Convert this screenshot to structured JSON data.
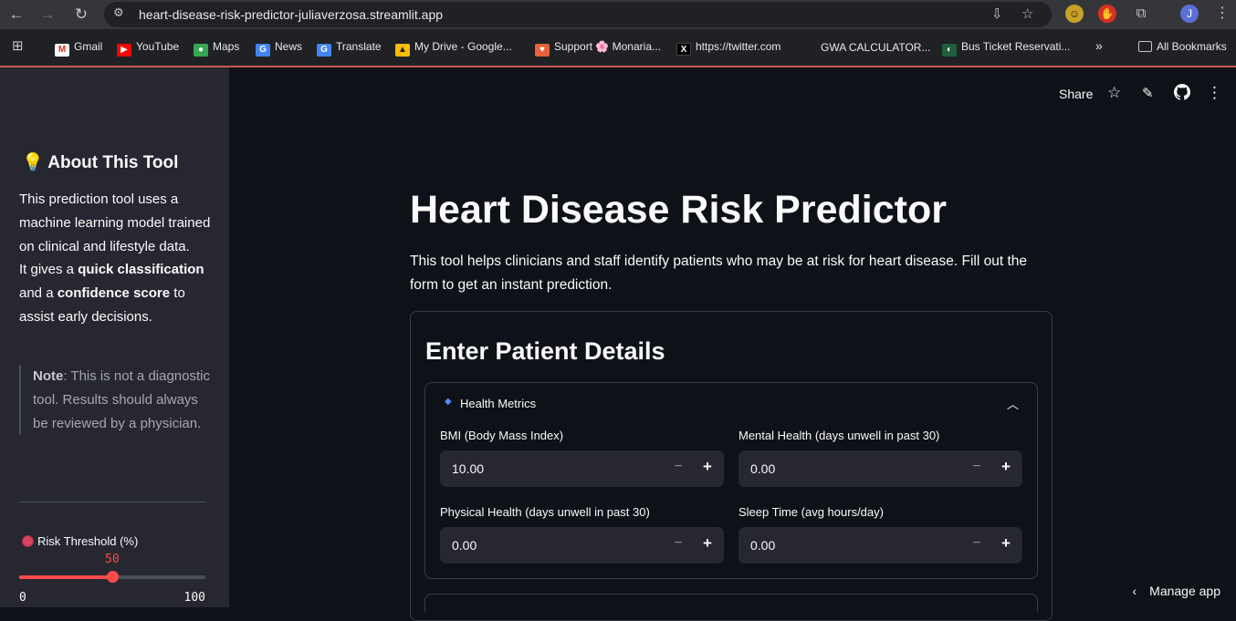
{
  "browser": {
    "url": "heart-disease-risk-predictor-juliaverzosa.streamlit.app",
    "profile_initial": "J",
    "bookmarks": [
      {
        "label": "Gmail",
        "icon": "gmail-icon"
      },
      {
        "label": "YouTube",
        "icon": "youtube-icon"
      },
      {
        "label": "Maps",
        "icon": "maps-icon"
      },
      {
        "label": "News",
        "icon": "news-icon"
      },
      {
        "label": "Translate",
        "icon": "translate-icon"
      },
      {
        "label": "My Drive - Google...",
        "icon": "drive-icon"
      },
      {
        "label": "Support 🌸 Monaria...",
        "icon": "support-icon"
      },
      {
        "label": "https://twitter.com",
        "icon": "x-icon"
      },
      {
        "label": "GWA CALCULATOR...",
        "icon": "page-icon"
      },
      {
        "label": "Bus Ticket Reservati...",
        "icon": "bus-icon"
      }
    ],
    "all_bookmarks": "All Bookmarks"
  },
  "topbar": {
    "share": "Share"
  },
  "sidebar": {
    "heading": "About This Tool",
    "heading_icon": "💡",
    "intro_1": "This prediction tool uses a machine learning model trained on clinical and lifestyle data.",
    "intro_2a": "It gives a ",
    "intro_2b": "quick classification",
    "intro_2c": " and a ",
    "intro_2d": "confidence score",
    "intro_2e": " to assist early decisions.",
    "note_bold": "Note",
    "note_text": ": This is not a diagnostic tool. Results should always be reviewed by a physician.",
    "slider_label": "Risk Threshold (%)",
    "slider_value": "50",
    "slider_fraction": 0.5,
    "slider_min": "0",
    "slider_max": "100",
    "accent_color": "#ff4b4b"
  },
  "main": {
    "title": "Heart Disease Risk Predictor",
    "intro": "This tool helps clinicians and staff identify patients who may be at risk for heart disease. Fill out the form to get an instant prediction.",
    "form_heading": "Enter Patient Details",
    "expander_title": "Health Metrics",
    "fields": {
      "bmi": {
        "label": "BMI (Body Mass Index)",
        "value": "10.00"
      },
      "mental": {
        "label": "Mental Health (days unwell in past 30)",
        "value": "0.00"
      },
      "physical": {
        "label": "Physical Health (days unwell in past 30)",
        "value": "0.00"
      },
      "sleep": {
        "label": "Sleep Time (avg hours/day)",
        "value": "0.00"
      }
    }
  },
  "manage_app": "Manage app"
}
